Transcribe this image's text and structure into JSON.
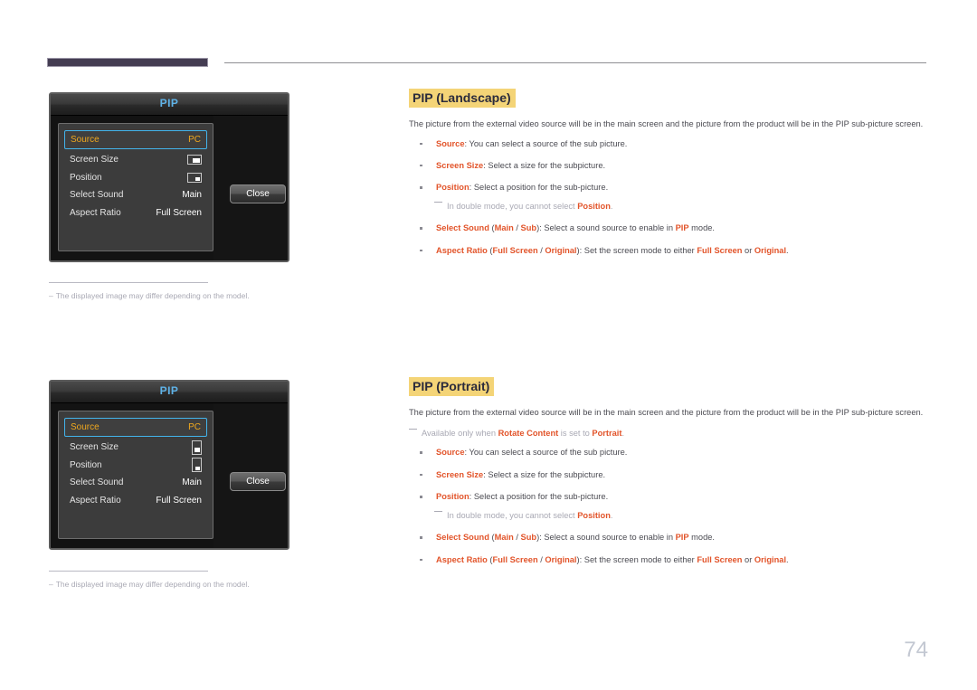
{
  "page": {
    "number": "74"
  },
  "colors": {
    "header_bar": "#443d52",
    "heading_highlight": "#f4d477",
    "term_accent": "#e2542a",
    "osd_selection_border": "#43b4ec",
    "osd_selection_text": "#f0a81e",
    "page_number": "#c3c8d2"
  },
  "osd_landscape": {
    "title": "PIP",
    "rows": [
      {
        "label": "Source",
        "value": "PC",
        "icon": null,
        "selected": true
      },
      {
        "label": "Screen Size",
        "value": "",
        "icon": "screen-size-landscape-icon",
        "selected": false
      },
      {
        "label": "Position",
        "value": "",
        "icon": "position-landscape-icon",
        "selected": false
      },
      {
        "label": "Select Sound",
        "value": "Main",
        "icon": null,
        "selected": false
      },
      {
        "label": "Aspect Ratio",
        "value": "Full Screen",
        "icon": null,
        "selected": false
      }
    ],
    "close_label": "Close"
  },
  "osd_portrait": {
    "title": "PIP",
    "rows": [
      {
        "label": "Source",
        "value": "PC",
        "icon": null,
        "selected": true
      },
      {
        "label": "Screen Size",
        "value": "",
        "icon": "screen-size-portrait-icon",
        "selected": false
      },
      {
        "label": "Position",
        "value": "",
        "icon": "position-portrait-icon",
        "selected": false
      },
      {
        "label": "Select Sound",
        "value": "Main",
        "icon": null,
        "selected": false
      },
      {
        "label": "Aspect Ratio",
        "value": "Full Screen",
        "icon": null,
        "selected": false
      }
    ],
    "close_label": "Close"
  },
  "figure_notes": {
    "landscape": "The displayed image may differ depending on the model.",
    "portrait": "The displayed image may differ depending on the model."
  },
  "sections": {
    "landscape": {
      "title": "PIP (Landscape)",
      "intro": "The picture from the external video source will be in the main screen and the picture from the product will be in the PIP sub-picture screen."
    },
    "portrait": {
      "title": "PIP (Portrait)",
      "intro": "The picture from the external video source will be in the main screen and the picture from the product will be in the PIP sub-picture screen.",
      "availability_note": {
        "prefix": "Available only when ",
        "term1": "Rotate Content",
        "middle": " is set to ",
        "term2": "Portrait",
        "suffix": "."
      }
    }
  },
  "bullets": {
    "source": {
      "term": "Source",
      "text": ": You can select a source of the sub picture."
    },
    "screen_size": {
      "term": "Screen Size",
      "text": ": Select a size for the subpicture."
    },
    "position": {
      "term": "Position",
      "text": ": Select a position for the sub-picture."
    },
    "position_note": {
      "prefix": "In double mode, you cannot select ",
      "term": "Position",
      "suffix": "."
    },
    "select_sound": {
      "term": "Select Sound",
      "open": " (",
      "opt1": "Main",
      "sep": " / ",
      "opt2": "Sub",
      "close": "): Select a sound source to enable in ",
      "mode": "PIP",
      "tail": " mode."
    },
    "aspect_ratio": {
      "term": "Aspect Ratio",
      "open": " (",
      "opt1": "Full Screen",
      "sep": " / ",
      "opt2": "Original",
      "close": "): Set the screen mode to either ",
      "val1": "Full Screen",
      "conj": " or ",
      "val2": "Original",
      "tail": "."
    }
  }
}
